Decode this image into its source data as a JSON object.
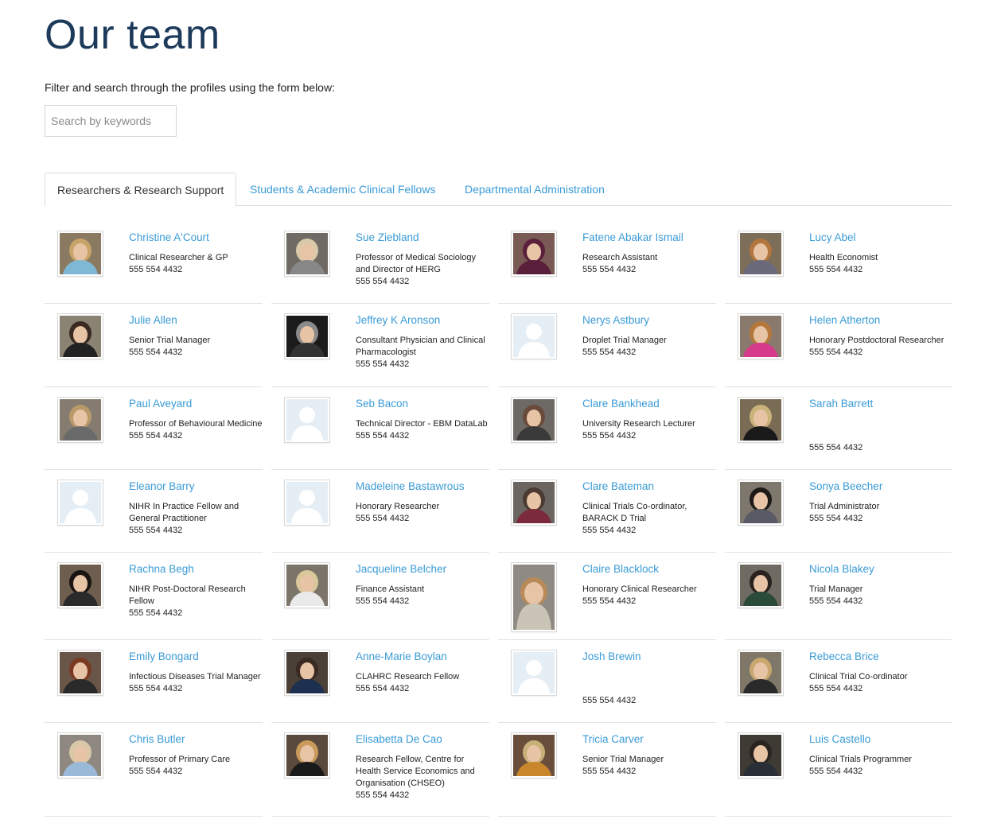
{
  "page": {
    "title": "Our team",
    "intro": "Filter and search through the profiles using the form below:",
    "search_placeholder": "Search by keywords"
  },
  "tabs": [
    {
      "label": "Researchers & Research Support",
      "active": true
    },
    {
      "label": "Students & Academic Clinical Fellows",
      "active": false
    },
    {
      "label": "Departmental Administration",
      "active": false
    }
  ],
  "colors": {
    "title": "#1d3a5a",
    "link": "#3a9bd6",
    "separator": "#e2e2e2",
    "placeholder_avatar_bg": "#e6eef5",
    "placeholder_avatar_fg": "#ffffff"
  },
  "people": [
    [
      {
        "name": "Christine A'Court",
        "role": "Clinical Researcher & GP",
        "phone": "555 554 4432",
        "photo": "portrait"
      },
      {
        "name": "Sue Ziebland",
        "role": "Professor of Medical Sociology and Director of HERG",
        "phone": "555 554 4432",
        "photo": "portrait"
      },
      {
        "name": "Fatene Abakar Ismail",
        "role": "Research Assistant",
        "phone": "555 554 4432",
        "photo": "portrait"
      },
      {
        "name": "Lucy Abel",
        "role": "Health Economist",
        "phone": "555 554 4432",
        "photo": "portrait"
      }
    ],
    [
      {
        "name": "Julie Allen",
        "role": "Senior Trial Manager",
        "phone": "555 554 4432",
        "photo": "portrait"
      },
      {
        "name": "Jeffrey K Aronson",
        "role": "Consultant Physician and Clinical Pharmacologist",
        "phone": "555 554 4432",
        "photo": "portrait"
      },
      {
        "name": "Nerys Astbury",
        "role": "Droplet Trial Manager",
        "phone": "555 554 4432",
        "photo": "placeholder"
      },
      {
        "name": "Helen Atherton",
        "role": "Honorary Postdoctoral Researcher",
        "phone": "555 554 4432",
        "photo": "portrait"
      }
    ],
    [
      {
        "name": "Paul Aveyard",
        "role": "Professor of Behavioural Medicine",
        "phone": "555 554 4432",
        "photo": "portrait"
      },
      {
        "name": "Seb Bacon",
        "role": "Technical Director - EBM DataLab",
        "phone": "555 554 4432",
        "photo": "placeholder"
      },
      {
        "name": "Clare Bankhead",
        "role": "University Research Lecturer",
        "phone": "555 554 4432",
        "photo": "portrait"
      },
      {
        "name": "Sarah Barrett",
        "role": "",
        "phone": "555 554 4432",
        "photo": "portrait"
      }
    ],
    [
      {
        "name": "Eleanor Barry",
        "role": "NIHR In Practice Fellow and General Practitioner",
        "phone": "555 554 4432",
        "photo": "placeholder"
      },
      {
        "name": "Madeleine Bastawrous",
        "role": "Honorary Researcher",
        "phone": "555 554 4432",
        "photo": "placeholder"
      },
      {
        "name": "Clare Bateman",
        "role": "Clinical Trials Co-ordinator, BARACK D Trial",
        "phone": "555 554 4432",
        "photo": "portrait"
      },
      {
        "name": "Sonya Beecher",
        "role": "Trial Administrator",
        "phone": "555 554 4432",
        "photo": "portrait"
      }
    ],
    [
      {
        "name": "Rachna Begh",
        "role": "NIHR Post-Doctoral Research Fellow",
        "phone": "555 554 4432",
        "photo": "portrait"
      },
      {
        "name": "Jacqueline Belcher",
        "role": "Finance Assistant",
        "phone": "555 554 4432",
        "photo": "portrait"
      },
      {
        "name": "Claire Blacklock",
        "role": "Honorary Clinical Researcher",
        "phone": "555 554 4432",
        "photo": "portrait"
      },
      {
        "name": "Nicola Blakey",
        "role": "Trial Manager",
        "phone": "555 554 4432",
        "photo": "portrait"
      }
    ],
    [
      {
        "name": "Emily Bongard",
        "role": "Infectious Diseases Trial Manager",
        "phone": "555 554 4432",
        "photo": "portrait"
      },
      {
        "name": "Anne-Marie Boylan",
        "role": "CLAHRC Research Fellow",
        "phone": "555 554 4432",
        "photo": "portrait"
      },
      {
        "name": "Josh Brewin",
        "role": "",
        "phone": "555 554 4432",
        "photo": "placeholder"
      },
      {
        "name": "Rebecca Brice",
        "role": "Clinical Trial Co-ordinator",
        "phone": "555 554 4432",
        "photo": "portrait"
      }
    ],
    [
      {
        "name": "Chris Butler",
        "role": "Professor of Primary Care",
        "phone": "555 554 4432",
        "photo": "portrait"
      },
      {
        "name": "Elisabetta De Cao",
        "role": "Research Fellow, Centre for Health Service Economics and Organisation (CHSEO)",
        "phone": "555 554 4432",
        "photo": "portrait"
      },
      {
        "name": "Tricia Carver",
        "role": "Senior Trial Manager",
        "phone": "555 554 4432",
        "photo": "portrait"
      },
      {
        "name": "Luis Castello",
        "role": "Clinical Trials Programmer",
        "phone": "555 554 4432",
        "photo": "portrait"
      }
    ]
  ]
}
